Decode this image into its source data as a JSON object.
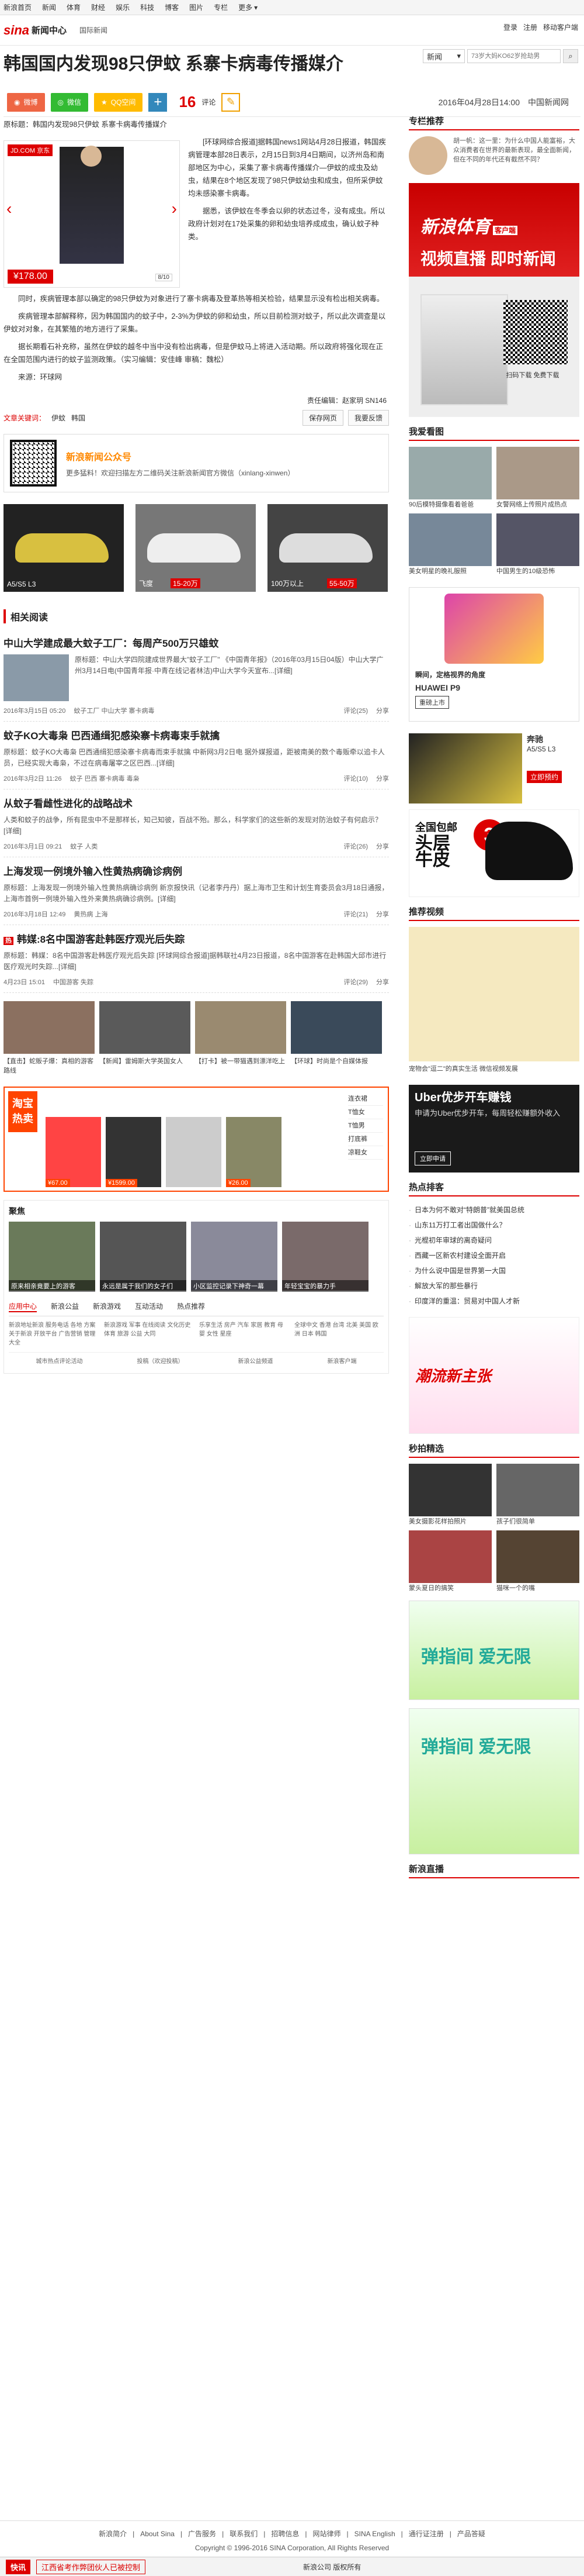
{
  "top_nav": {
    "items": [
      "新浪首页",
      "新闻",
      "体育",
      "财经",
      "娱乐",
      "科技",
      "博客",
      "图片",
      "专栏"
    ],
    "more": "更多"
  },
  "header": {
    "logo": "sina",
    "logo_sub": "新闻中心",
    "breadcrumb": [
      "国际新闻"
    ],
    "search_select": "新闻",
    "search_placeholder": "73岁大妈KO62岁抢劫男",
    "login": "登录",
    "register": "注册",
    "mobile": "移动客户端"
  },
  "article": {
    "title": "韩国国内发现98只伊蚊 系寨卡病毒传播媒介",
    "share": [
      "微博",
      "微信",
      "QQ空间"
    ],
    "comment_count": "16",
    "comment_unit": "评论",
    "date": "2016年04月28日14:00",
    "source": "中国新闻网",
    "orig_title": "原标题：韩国内发现98只伊蚊 系寨卡病毒传播媒介",
    "paragraphs": [
      "[环球网综合报道]据韩国news1网站4月28日报道，韩国疾病管理本部28日表示，2月15日到3月4日期间，以济州岛和南部地区为中心，采集了寨卡病毒传播媒介—伊蚊的成虫及幼虫，结果在8个地区发现了98只伊蚊幼虫和成虫，但所采伊蚊均未感染寨卡病毒。",
      "据悉，该伊蚊在冬季会以卵的状态过冬，没有成虫。所以政府计划对在17处采集的卵和幼虫培养成成虫，确认蚊子种类。",
      "同时，疾病管理本部以确定的98只伊蚊为对象进行了寨卡病毒及登革热等相关检验，结果显示没有检出相关病毒。",
      "疾病管理本部解释称，因为韩国国内的蚊子中，2-3%为伊蚊的卵和幼虫，所以目前检测对蚊子，所以此次调查是以伊蚊对对象，在其繁殖的地方进行了采集。",
      "据长期看石补充称，虽然在伊蚊的越冬中当中没有检出病毒，但是伊蚊马上将进入活动期。所以政府将强化现在正在全国范围内进行的蚊子监测政策。（实习编辑：安佳峰 审稿：魏松）"
    ],
    "source_line": "来源：环球网",
    "ad_price": "¥178.00",
    "ad_badge": "JD.COM 京东",
    "ad_page": "8/10",
    "editor": "责任编辑：赵家玥 SN146",
    "tag_label": "文章关键词：",
    "tags": [
      "伊蚊",
      "韩国"
    ],
    "btn_save": "保存网页",
    "btn_error": "我要反馈"
  },
  "wechat": {
    "title": "新浪新闻公众号",
    "desc": "更多猛料！欢迎扫描左方二维码关注新浪新闻官方微信（xinlang-xinwen）"
  },
  "cars": [
    {
      "label": "A5/S5 L3"
    },
    {
      "label": "飞度"
    },
    {
      "label": "15-20万"
    },
    {
      "label": "55-50万"
    }
  ],
  "cars_extra": [
    "100万以上"
  ],
  "related": {
    "title": "相关阅读",
    "items": [
      {
        "title": "中山大学建成最大蚊子工厂：每周产500万只雄蚊",
        "body": "原标题：中山大学四院建成世界最大\"蚊子工厂\" 《中国青年报》（2016年03月15日04版）中山大学广州3月14日电(中国青年报·中青在线记者林洁)中山大学今天宣布...[详细]",
        "date": "2016年3月15日 05:20",
        "tags": "蚊子工厂  中山大学  寨卡病毒",
        "comments": "评论(25)",
        "share": "分享"
      },
      {
        "title": "蚊子KO大毒枭 巴西通缉犯感染寨卡病毒束手就擒",
        "body": "原标题：蚊子KO大毒枭 巴西通缉犯感染寨卡病毒而束手就擒 中新网3月2日电 据外媒报道，距被南美的数个毒贩牵以追卡人员，已经实现大毒枭，不过在病毒屠宰之区巴西...[详细]",
        "date": "2016年3月2日 11:26",
        "tags": "蚊子  巴西  寨卡病毒  毒枭",
        "comments": "评论(10)",
        "share": "分享"
      },
      {
        "title": "从蚊子看雌性进化的战略战术",
        "body": "人类和蚊子的战争，所有昆虫中不是那样长，知己知彼，百战不殆。那么，科学家们的这些新的发现对防治蚊子有何启示？[详细]",
        "date": "2016年3月1日 09:21",
        "tags": "蚊子  人类",
        "comments": "评论(26)",
        "share": "分享"
      },
      {
        "title": "上海发现一例境外输入性黄热病确诊病例",
        "body": "原标题：上海发现一例境外输入性黄热病确诊病例 新京报快讯（记者李丹丹）据上海市卫生和计划生育委员会3月18日通报，上海市首例一例境外输入性外来黄热病确诊病例。[详细]",
        "date": "2016年3月18日 12:49",
        "tags": "黄热病  上海",
        "comments": "评论(21)",
        "share": "分享"
      },
      {
        "title": "韩媒:8名中国游客赴韩医疗观光后失踪",
        "body": "原标题：韩媒：8名中国游客赴韩医疗观光后失踪 [环球网综合报道]据韩联社4月23日报道，8名中国游客在赴韩国大邱市进行医疗观光时失踪...[详细]",
        "date": "4月23日 15:01",
        "tags": "中国游客  失踪",
        "comments": "评论(29)",
        "share": "分享"
      }
    ]
  },
  "pics": [
    "【直击】蛇贩子爆：真相的游客路线",
    "【新闻】雷姆斯大学英国女人",
    "【打卡】被一带猫遇到漂洋吃上",
    "【环球】时尚是个自媒体报"
  ],
  "taobao": {
    "logo": "淘宝热卖",
    "prices": [
      "¥67.00",
      "¥1599.00",
      "¥26.00"
    ],
    "menu": [
      "连衣裙",
      "T恤女",
      "T恤男",
      "打底裤",
      "凉鞋女"
    ]
  },
  "gallery": {
    "title": "聚焦",
    "items": [
      "原来相亲竟要上的游客",
      "永远是属于我们的女子们",
      "小区监控记录下神奇一幕",
      "年轻宝宝的暴力手"
    ],
    "tabs": [
      "应用中心",
      "新浪公益",
      "新浪游戏",
      "互动活动",
      "热点推荐"
    ],
    "grid": [
      "新浪地址新浪 服务电话 各地 方案 关于新浪 开放平台 广告营销 管理大全",
      "新浪游戏 军事 在线阅读 文化历史 体育 旅游 公益 大同",
      "乐享生活 房产 汽车 家居 教育 母婴 女性 星座",
      "全球中文 香港 台湾 北美 美国 欧洲 日本 韩国"
    ],
    "links": [
      "城市热点评论活动",
      "投稿（欢迎投稿）",
      "新浪公益频道",
      "新浪客户端"
    ]
  },
  "side": {
    "expert_title": "专栏推荐",
    "expert_text": "胡一帆：这一里：为什么中国人能富裕，大众消费者在世界的最新表现，最全面新闻，但在不同的年代还有截然不同？",
    "ad_sport_1": "新浪体育",
    "ad_sport_app": "客户端",
    "ad_sport_2": "视频直播 即时新闻",
    "ad_sport_scan": "扫码下载 免费下载",
    "hot_title": "我爱看图",
    "hot_items": [
      "90后模特摄像看着爸爸",
      "女警网络上传照片成热点",
      "美女明星的晚礼服照",
      "中国男生的10级恐怖"
    ],
    "ad_phone_text": "瞬间，定格视界的角度",
    "ad_phone_brand": "HUAWEI P9",
    "ad_phone_cta": "重磅上市",
    "ad_car_text": "奔驰",
    "ad_car_sub": "A5/S5 L3",
    "ad_car_btn": "立即预约",
    "ad_shoes_1": "全国包邮",
    "ad_shoes_2": "头层",
    "ad_shoes_3": "牛皮",
    "video_title": "推荐视频",
    "video_caption": "宠物会\"逗二\"的真实生活 微信视频发展",
    "uber_1": "Uber优步开车赚钱",
    "uber_2": "申请为Uber优步开车，每周轻松赚额外收入",
    "uber_btn": "立即申请",
    "hot_list_title": "热点排客",
    "hot_list": [
      "日本为何不敢对“特朗普”就美国总统",
      "山东11万打工者出国做什么？",
      "光棍初年审球的离奇疑问",
      "西藏一区新农村建设全面开启",
      "为什么说中国是世界第一大国",
      "解放大军的那些暴行",
      "印度洋的重温：贸易对中国人才新"
    ],
    "ad_cfp": "潮流新主张",
    "pic_title": "秒拍精选",
    "pic_items": [
      "美女摄影花样拍照片",
      "孩子们很简单",
      "蒙头夏日的搞笑",
      "猫咪一个的嘴"
    ],
    "ad_green_1": "弹指间 爱无限",
    "ad_green_2": "弹指间 爱无限",
    "sports_title": "新浪直播"
  },
  "footer": {
    "links": [
      "新浪简介",
      "About Sina",
      "广告服务",
      "联系我们",
      "招聘信息",
      "网站律师",
      "SINA English",
      "通行证注册",
      "产品答疑"
    ],
    "copyright": "Copyright © 1996-2016 SINA Corporation, All Rights Reserved",
    "company": "新浪公司 版权所有"
  },
  "bottom_bar": {
    "label": "快讯",
    "text": "江西省考作弊团伙人已被控制"
  }
}
